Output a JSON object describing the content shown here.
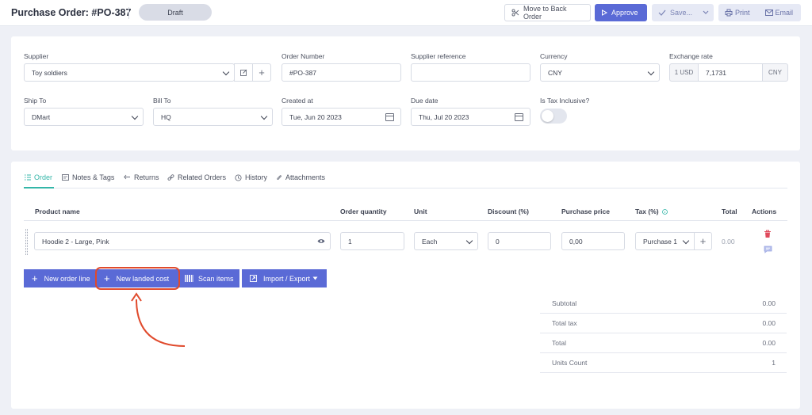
{
  "header": {
    "title": "Purchase Order: #PO-387",
    "status": "Draft",
    "move_back_label": "Move to Back Order",
    "approve_label": "Approve",
    "save_label": "Save...",
    "print_label": "Print",
    "email_label": "Email"
  },
  "form": {
    "supplier": {
      "label": "Supplier",
      "value": "Toy soldiers"
    },
    "order_number": {
      "label": "Order Number",
      "value": "#PO-387"
    },
    "supplier_reference": {
      "label": "Supplier reference",
      "value": ""
    },
    "currency": {
      "label": "Currency",
      "value": "CNY"
    },
    "exchange_rate": {
      "label": "Exchange rate",
      "base": "1 USD",
      "value": "7,1731",
      "unit": "CNY"
    },
    "ship_to": {
      "label": "Ship To",
      "value": "DMart"
    },
    "bill_to": {
      "label": "Bill To",
      "value": "HQ"
    },
    "created_at": {
      "label": "Created at",
      "value": "Tue, Jun 20 2023"
    },
    "due_date": {
      "label": "Due date",
      "value": "Thu, Jul 20 2023"
    },
    "tax_inclusive": {
      "label": "Is Tax Inclusive?",
      "on": false
    }
  },
  "tabs": [
    {
      "label": "Order",
      "icon": "list-icon",
      "active": true
    },
    {
      "label": "Notes & Tags",
      "icon": "note-icon",
      "active": false
    },
    {
      "label": "Returns",
      "icon": "return-icon",
      "active": false
    },
    {
      "label": "Related Orders",
      "icon": "link-icon",
      "active": false
    },
    {
      "label": "History",
      "icon": "history-icon",
      "active": false
    },
    {
      "label": "Attachments",
      "icon": "paperclip-icon",
      "active": false
    }
  ],
  "table": {
    "headers": {
      "product": "Product name",
      "quantity": "Order quantity",
      "unit": "Unit",
      "discount": "Discount (%)",
      "price": "Purchase price",
      "tax": "Tax (%)",
      "total": "Total",
      "actions": "Actions"
    },
    "rows": [
      {
        "product": "Hoodie 2 - Large, Pink",
        "quantity": "1",
        "unit": "Each",
        "discount": "0",
        "price": "0,00",
        "tax": "Purchase 1",
        "total": "0.00"
      }
    ]
  },
  "actions": {
    "new_order_line": "New order line",
    "new_landed_cost": "New landed cost",
    "scan_items": "Scan items",
    "import_export": "Import / Export"
  },
  "summary": [
    {
      "label": "Subtotal",
      "value": "0.00"
    },
    {
      "label": "Total tax",
      "value": "0.00"
    },
    {
      "label": "Total",
      "value": "0.00"
    },
    {
      "label": "Units Count",
      "value": "1"
    }
  ],
  "colors": {
    "primary": "#5a6ad6",
    "accent_tab": "#33b6a8",
    "annotation": "#e04a2c",
    "delete": "#e04a5c"
  }
}
